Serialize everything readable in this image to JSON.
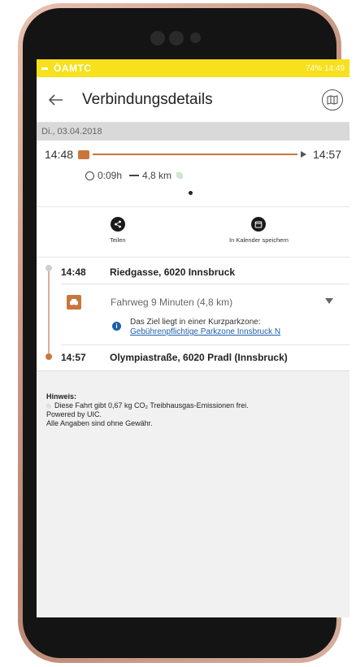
{
  "status_bar": {
    "carrier": "ÖAMTC",
    "right": "74% 14:49"
  },
  "app_bar": {
    "title": "Verbindungsdetails"
  },
  "date": "Di., 03.04.2018",
  "summary": {
    "start_time": "14:48",
    "end_time": "14:57",
    "duration": "0:09h",
    "distance": "4,8 km"
  },
  "actions": [
    {
      "label": "Teilen",
      "icon": "share-icon"
    },
    {
      "label": "In Kalender speichern",
      "icon": "calendar-icon"
    }
  ],
  "route": {
    "start": {
      "time": "14:48",
      "name": "Riedgasse, 6020 Innsbruck"
    },
    "leg": {
      "text": "Fahrweg 9 Minuten (4,8 km)",
      "icon": "car-icon"
    },
    "info": {
      "line1": "Das Ziel liegt in einer Kurzparkzone:",
      "link": "Gebührenpflichtige Parkzone Innsbruck N"
    },
    "end": {
      "time": "14:57",
      "name": "Olympiastraße, 6020 Pradl (Innsbruck)"
    }
  },
  "notes": {
    "title": "Hinweis:",
    "line1": "Diese Fahrt gibt 0,67 kg CO₂ Treibhausgas-Emissionen frei.",
    "line2": "Powered by UIC.",
    "line3": "Alle Angaben sind ohne Gewähr."
  },
  "colors": {
    "status_yellow": "#f6e11c",
    "accent_orange": "#c8763b",
    "link_blue": "#1f5fa8"
  }
}
